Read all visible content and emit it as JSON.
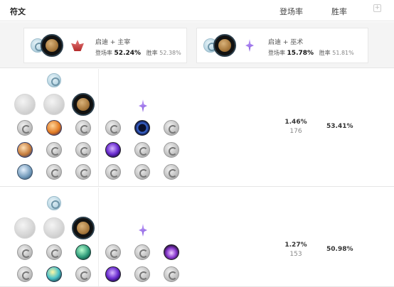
{
  "header": {
    "title": "符文",
    "pick_rate_label": "登场率",
    "win_rate_label": "胜率",
    "add_label": "+"
  },
  "summaries": [
    {
      "name": "启迪 + 主宰",
      "pick_label": "登场率",
      "pick_rate": "52.24%",
      "win_label": "胜率",
      "win_rate": "52.38%"
    },
    {
      "name": "启迪 + 巫术",
      "pick_label": "登场率",
      "pick_rate": "15.78%",
      "win_label": "胜率",
      "win_rate": "51.81%"
    }
  ],
  "pages": [
    {
      "pick_rate": "1.46%",
      "games": "176",
      "win_rate": "53.41%"
    },
    {
      "pick_rate": "1.27%",
      "games": "153",
      "win_rate": "50.98%"
    }
  ],
  "icons": {
    "shard": "rune-shard-icon",
    "keystone": "keystone-rune-icon",
    "domination": "domination-tree-icon",
    "sorcery": "sorcery-tree-icon"
  },
  "colors": {
    "accent_pick": "#111111",
    "divider": "#e6e6e6",
    "band": "#f4f4f4"
  }
}
